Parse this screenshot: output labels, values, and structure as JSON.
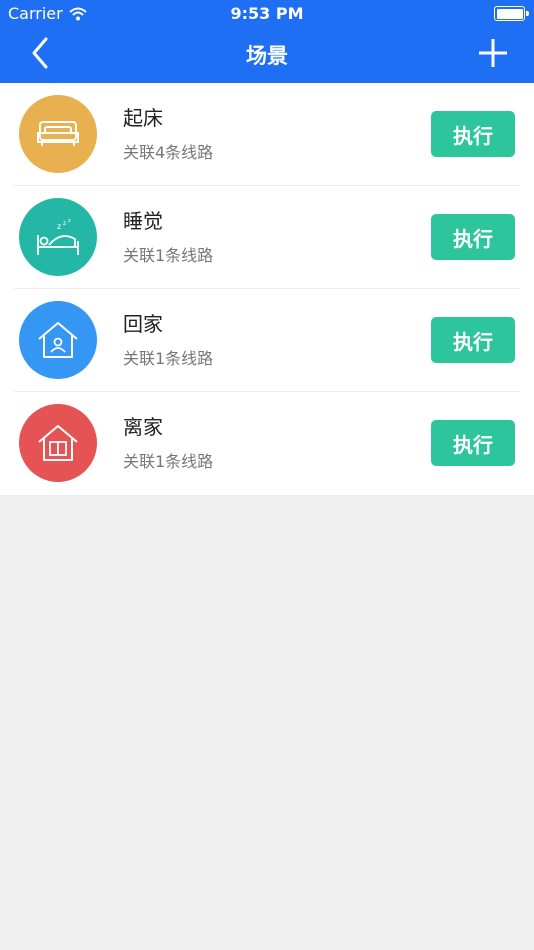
{
  "status_bar": {
    "carrier": "Carrier",
    "time": "9:53 PM"
  },
  "nav": {
    "title": "场景"
  },
  "scenes": [
    {
      "name": "起床",
      "desc": "关联4条线路",
      "action": "执行",
      "icon": "sofa-icon",
      "color": "#e9b050"
    },
    {
      "name": "睡觉",
      "desc": "关联1条线路",
      "action": "执行",
      "icon": "sleep-bed-icon",
      "color": "#25b7a6"
    },
    {
      "name": "回家",
      "desc": "关联1条线路",
      "action": "执行",
      "icon": "home-person-icon",
      "color": "#3596f4"
    },
    {
      "name": "离家",
      "desc": "关联1条线路",
      "action": "执行",
      "icon": "home-door-icon",
      "color": "#e55354"
    }
  ],
  "colors": {
    "nav_bg": "#1f6ff5",
    "execute_button": "#2dc59c",
    "page_bg": "#efefef"
  }
}
